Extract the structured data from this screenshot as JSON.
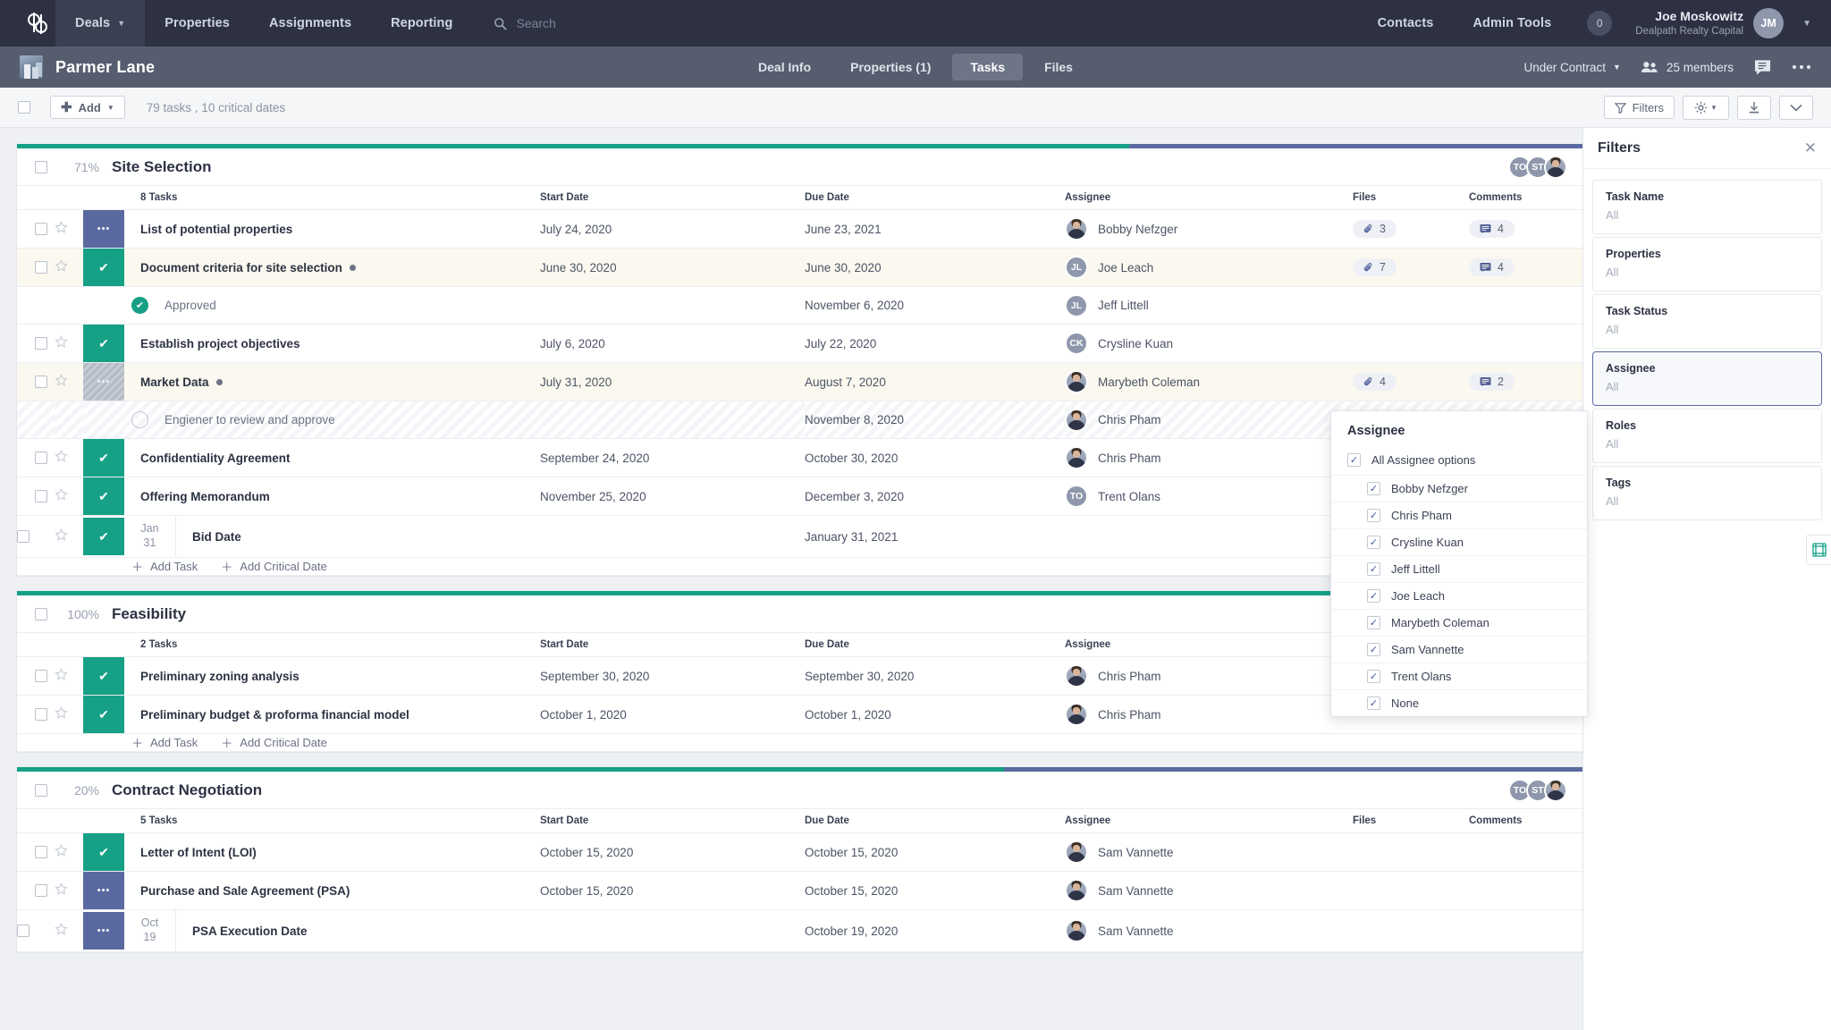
{
  "topnav": {
    "logo": "dp-logo",
    "items": [
      {
        "label": "Deals",
        "active": true,
        "caret": true
      },
      {
        "label": "Properties",
        "active": false,
        "caret": false
      },
      {
        "label": "Assignments",
        "active": false,
        "caret": false
      },
      {
        "label": "Reporting",
        "active": false,
        "caret": false
      }
    ],
    "search_placeholder": "Search",
    "search_value": "",
    "right_items": [
      {
        "label": "Contacts"
      },
      {
        "label": "Admin Tools"
      }
    ],
    "notification_count": "0",
    "user_name": "Joe Moskowitz",
    "user_org": "Dealpath Realty Capital",
    "user_initials": "JM"
  },
  "dealbar": {
    "title": "Parmer Lane",
    "tabs": [
      {
        "label": "Deal Info",
        "active": false
      },
      {
        "label": "Properties (1)",
        "active": false
      },
      {
        "label": "Tasks",
        "active": true
      },
      {
        "label": "Files",
        "active": false
      }
    ],
    "status": "Under Contract",
    "members": "25 members"
  },
  "toolbar": {
    "add_label": "Add",
    "counts": "79 tasks , 10 critical dates",
    "filters_label": "Filters"
  },
  "columns": {
    "tasks_count_header": "8 Tasks",
    "start": "Start Date",
    "due": "Due Date",
    "assignee": "Assignee",
    "files": "Files",
    "comments": "Comments"
  },
  "add_row": {
    "task": "Add Task",
    "critical": "Add Critical Date"
  },
  "groups": [
    {
      "name": "Site Selection",
      "percent": "71%",
      "progress_done": 71,
      "progress_rest": 29,
      "tasks_header": "8 Tasks",
      "avatars": [
        {
          "initials": "TO",
          "photo": false
        },
        {
          "initials": "ST",
          "photo": false
        },
        {
          "initials": "",
          "photo": true
        }
      ],
      "rows": [
        {
          "kind": "task",
          "status": "progress",
          "name": "List of potential properties",
          "flag": false,
          "start": "July 24, 2020",
          "due": "June 23, 2021",
          "assignee": "Bobby Nefzger",
          "assignee_initials": "BN",
          "assignee_photo": true,
          "files": "3",
          "comments": "4",
          "highlight": false
        },
        {
          "kind": "task",
          "status": "done",
          "name": "Document criteria for site selection",
          "flag": true,
          "start": "June 30, 2020",
          "due": "June 30, 2020",
          "assignee": "Joe Leach",
          "assignee_initials": "JL",
          "assignee_photo": false,
          "files": "7",
          "comments": "4",
          "highlight": true
        },
        {
          "kind": "sub",
          "sub_state": "approved",
          "name": "Approved",
          "start": "",
          "due": "November 6, 2020",
          "assignee": "Jeff Littell",
          "assignee_initials": "JL",
          "assignee_photo": false,
          "hatched": false
        },
        {
          "kind": "task",
          "status": "done",
          "name": "Establish project objectives",
          "flag": false,
          "start": "July 6, 2020",
          "due": "July 22, 2020",
          "assignee": "Crysline Kuan",
          "assignee_initials": "CK",
          "assignee_photo": false,
          "files": "",
          "comments": "",
          "highlight": false
        },
        {
          "kind": "task",
          "status": "hold",
          "name": "Market Data",
          "flag": true,
          "start": "July 31, 2020",
          "due": "August 7, 2020",
          "assignee": "Marybeth Coleman",
          "assignee_initials": "MC",
          "assignee_photo": true,
          "files": "4",
          "comments": "2",
          "highlight": true
        },
        {
          "kind": "sub",
          "sub_state": "open",
          "name": "Engiener to review and approve",
          "start": "",
          "due": "November 8, 2020",
          "assignee": "Chris Pham",
          "assignee_initials": "CP",
          "assignee_photo": true,
          "hatched": true
        },
        {
          "kind": "task",
          "status": "done",
          "name": "Confidentiality Agreement",
          "flag": false,
          "start": "September 24, 2020",
          "due": "October 30, 2020",
          "assignee": "Chris Pham",
          "assignee_initials": "CP",
          "assignee_photo": true,
          "files": "",
          "comments": "",
          "highlight": false
        },
        {
          "kind": "task",
          "status": "done",
          "name": "Offering Memorandum",
          "flag": false,
          "start": "November 25, 2020",
          "due": "December 3, 2020",
          "assignee": "Trent Olans",
          "assignee_initials": "TO",
          "assignee_photo": false,
          "files": "",
          "comments": "",
          "highlight": false
        },
        {
          "kind": "critical",
          "status": "done",
          "month": "Jan",
          "day": "31",
          "name": "Bid Date",
          "start": "",
          "due": "January 31, 2021",
          "assignee": "",
          "assignee_initials": "",
          "assignee_photo": false
        }
      ]
    },
    {
      "name": "Feasibility",
      "percent": "100%",
      "progress_done": 100,
      "progress_rest": 0,
      "tasks_header": "2 Tasks",
      "avatars": [],
      "rows": [
        {
          "kind": "task",
          "status": "done",
          "name": "Preliminary zoning analysis",
          "flag": false,
          "start": "September 30, 2020",
          "due": "September 30, 2020",
          "assignee": "Chris Pham",
          "assignee_initials": "CP",
          "assignee_photo": true,
          "files": "",
          "comments": "",
          "highlight": false
        },
        {
          "kind": "task",
          "status": "done",
          "name": "Preliminary budget & proforma financial model",
          "flag": false,
          "start": "October 1, 2020",
          "due": "October 1, 2020",
          "assignee": "Chris Pham",
          "assignee_initials": "CP",
          "assignee_photo": true,
          "files": "",
          "comments": "",
          "highlight": false
        }
      ]
    },
    {
      "name": "Contract Negotiation",
      "percent": "20%",
      "progress_done": 63,
      "progress_rest": 37,
      "tasks_header": "5 Tasks",
      "avatars": [
        {
          "initials": "TO",
          "photo": false
        },
        {
          "initials": "ST",
          "photo": false
        },
        {
          "initials": "",
          "photo": true
        }
      ],
      "rows": [
        {
          "kind": "task",
          "status": "done",
          "name": "Letter of Intent (LOI)",
          "flag": false,
          "start": "October 15, 2020",
          "due": "October 15, 2020",
          "assignee": "Sam Vannette",
          "assignee_initials": "SV",
          "assignee_photo": true,
          "files": "",
          "comments": "",
          "highlight": false
        },
        {
          "kind": "task",
          "status": "progress",
          "name": "Purchase and Sale Agreement (PSA)",
          "flag": false,
          "start": "October 15, 2020",
          "due": "October 15, 2020",
          "assignee": "Sam Vannette",
          "assignee_initials": "SV",
          "assignee_photo": true,
          "files": "",
          "comments": "",
          "highlight": false
        },
        {
          "kind": "critical",
          "status": "progress",
          "month": "Oct",
          "day": "19",
          "name": "PSA Execution Date",
          "start": "",
          "due": "October 19, 2020",
          "assignee": "Sam Vannette",
          "assignee_initials": "SV",
          "assignee_photo": true
        }
      ]
    }
  ],
  "filters": {
    "title": "Filters",
    "cards": [
      {
        "label": "Task Name",
        "value": "All",
        "selected": false
      },
      {
        "label": "Properties",
        "value": "All",
        "selected": false
      },
      {
        "label": "Task Status",
        "value": "All",
        "selected": false
      },
      {
        "label": "Assignee",
        "value": "All",
        "selected": true
      },
      {
        "label": "Roles",
        "value": "All",
        "selected": false
      },
      {
        "label": "Tags",
        "value": "All",
        "selected": false
      }
    ]
  },
  "assignee_popover": {
    "title": "Assignee",
    "all_label": "All Assignee options",
    "all_checked": true,
    "options": [
      {
        "label": "Bobby Nefzger",
        "checked": true
      },
      {
        "label": "Chris Pham",
        "checked": true
      },
      {
        "label": "Crysline Kuan",
        "checked": true
      },
      {
        "label": "Jeff Littell",
        "checked": true
      },
      {
        "label": "Joe Leach",
        "checked": true
      },
      {
        "label": "Marybeth Coleman",
        "checked": true
      },
      {
        "label": "Sam Vannette",
        "checked": true
      },
      {
        "label": "Trent Olans",
        "checked": true
      },
      {
        "label": "None",
        "checked": true
      }
    ]
  },
  "colors": {
    "green": "#16a085",
    "blue": "#5a6aa0",
    "navy": "#2d3142"
  }
}
